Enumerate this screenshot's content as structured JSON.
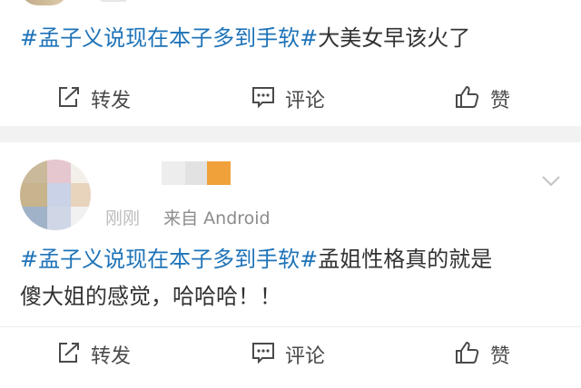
{
  "post1": {
    "topic": "#孟子义说现在本子多到手软#",
    "text": "大美女早该火了"
  },
  "actions": {
    "repost_label": "转发",
    "comment_label": "评论",
    "like_label": "赞"
  },
  "post2": {
    "time": "刚刚",
    "source": "来自 Android",
    "topic": "#孟子义说现在本子多到手软#",
    "text_line1": "孟姐性格真的就是",
    "text_line2": "傻大姐的感觉，哈哈哈！！"
  },
  "colors": {
    "topic_link": "#1e73b8",
    "text": "#333333",
    "meta": "#8c8c8c",
    "separator": "#f2f2f2"
  },
  "icons": [
    "repost-icon",
    "comment-icon",
    "like-icon",
    "chevron-down-icon"
  ]
}
